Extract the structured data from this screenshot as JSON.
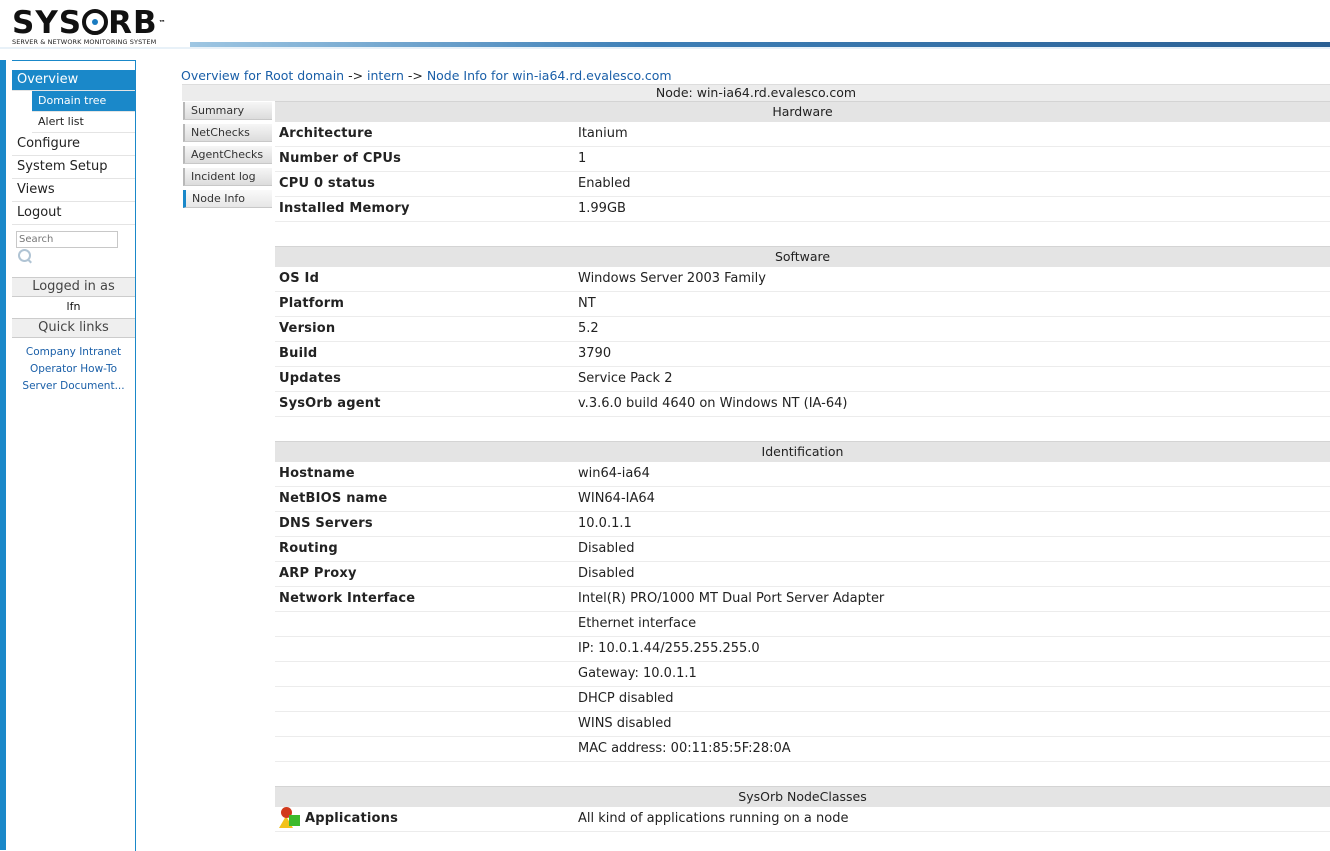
{
  "logo": {
    "text_left": "SYS",
    "text_right": "RB",
    "tm": "™",
    "subtitle": "SERVER & NETWORK MONITORING SYSTEM"
  },
  "sidebar": {
    "items": [
      {
        "label": "Overview",
        "active": true
      },
      {
        "label": "Domain tree",
        "sub": true,
        "active": true
      },
      {
        "label": "Alert list",
        "sub": true
      },
      {
        "label": "Configure"
      },
      {
        "label": "System Setup"
      },
      {
        "label": "Views"
      },
      {
        "label": "Logout"
      }
    ],
    "search_placeholder": "Search",
    "logged_in_label": "Logged in as",
    "logged_in_user": "lfn",
    "quick_links_label": "Quick links",
    "quick_links": [
      "Company Intranet",
      "Operator How-To",
      "Server Document..."
    ]
  },
  "breadcrumb": {
    "parts": [
      "Overview for Root domain",
      "intern",
      "Node Info for win-ia64.rd.evalesco.com"
    ],
    "sep": " -> "
  },
  "tabs": [
    "Summary",
    "NetChecks",
    "AgentChecks",
    "Incident log",
    "Node Info"
  ],
  "node_title": "Node: win-ia64.rd.evalesco.com",
  "sections": {
    "hardware": {
      "title": "Hardware",
      "rows": [
        [
          "Architecture",
          "Itanium"
        ],
        [
          "Number of CPUs",
          "1"
        ],
        [
          "CPU 0 status",
          "Enabled"
        ],
        [
          "Installed Memory",
          "1.99GB"
        ]
      ]
    },
    "software": {
      "title": "Software",
      "rows": [
        [
          "OS Id",
          "Windows Server 2003 Family"
        ],
        [
          "Platform",
          "NT"
        ],
        [
          "Version",
          "5.2"
        ],
        [
          "Build",
          "3790"
        ],
        [
          "Updates",
          "Service Pack 2"
        ],
        [
          "SysOrb agent",
          "v.3.6.0 build 4640 on Windows NT (IA-64)"
        ]
      ]
    },
    "identification": {
      "title": "Identification",
      "rows": [
        [
          "Hostname",
          "win64-ia64"
        ],
        [
          "NetBIOS name",
          "WIN64-IA64"
        ],
        [
          "DNS Servers",
          "10.0.1.1"
        ],
        [
          "Routing",
          "Disabled"
        ],
        [
          "ARP Proxy",
          "Disabled"
        ],
        [
          "Network Interface",
          "Intel(R) PRO/1000 MT Dual Port Server Adapter"
        ],
        [
          "",
          "Ethernet interface"
        ],
        [
          "",
          "IP: 10.0.1.44/255.255.255.0"
        ],
        [
          "",
          "Gateway: 10.0.1.1"
        ],
        [
          "",
          "DHCP disabled"
        ],
        [
          "",
          "WINS disabled"
        ],
        [
          "",
          "MAC address: 00:11:85:5F:28:0A"
        ]
      ]
    },
    "nodeclasses": {
      "title": "SysOrb NodeClasses",
      "rows": [
        [
          "Applications",
          "All kind of applications running on a node"
        ]
      ]
    }
  },
  "colors": {
    "accent": "#1a88c9",
    "link": "#1a5fa8"
  }
}
